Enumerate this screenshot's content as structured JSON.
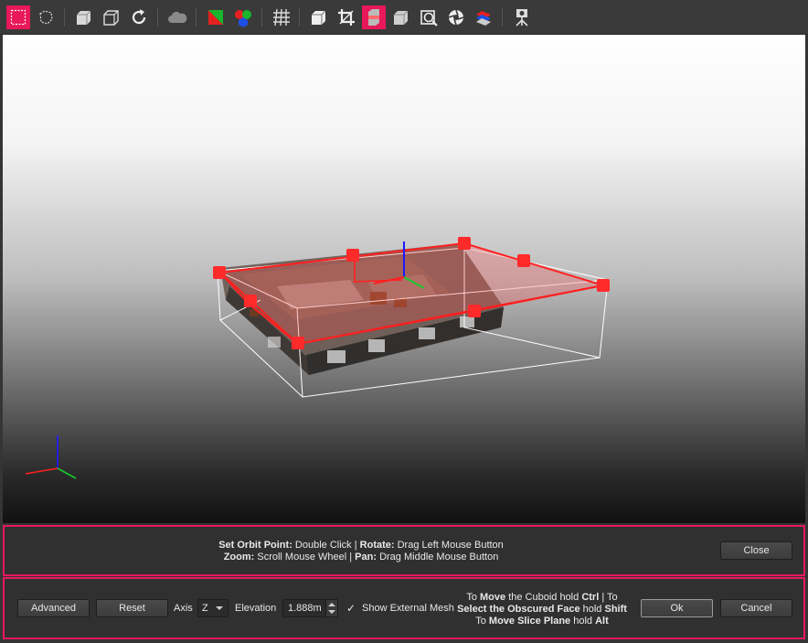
{
  "toolbar": {
    "buttons": [
      {
        "name": "rectangle-select-icon",
        "active": true
      },
      {
        "name": "lasso-select-icon",
        "active": false
      },
      {
        "name": "cuboid-add-icon",
        "active": false
      },
      {
        "name": "cuboid-remove-icon",
        "active": false
      },
      {
        "name": "rotate-icon",
        "active": false
      },
      {
        "name": "cloud-icon",
        "active": false
      },
      {
        "name": "color-icon",
        "active": false
      },
      {
        "name": "rgb-icon",
        "active": false
      },
      {
        "name": "grid-icon",
        "active": false
      },
      {
        "name": "box-view-icon",
        "active": false
      },
      {
        "name": "crop-icon",
        "active": false
      },
      {
        "name": "slice-icon",
        "active": true
      },
      {
        "name": "mesh-icon",
        "active": false
      },
      {
        "name": "camera-view-icon",
        "active": false
      },
      {
        "name": "aperture-icon",
        "active": false
      },
      {
        "name": "layers-icon",
        "active": false
      },
      {
        "name": "scanner-icon",
        "active": false
      }
    ]
  },
  "help": {
    "orbit_label": "Set Orbit Point:",
    "orbit_value": "Double Click",
    "sep1": "|",
    "rotate_label": "Rotate:",
    "rotate_value": "Drag Left Mouse Button",
    "zoom_label": "Zoom:",
    "zoom_value": "Scroll Mouse Wheel",
    "sep2": "|",
    "pan_label": "Pan:",
    "pan_value": "Drag Middle Mouse Button",
    "close_label": "Close"
  },
  "controls": {
    "advanced_label": "Advanced",
    "reset_label": "Reset",
    "axis_label": "Axis",
    "axis_value": "Z",
    "elevation_label": "Elevation",
    "elevation_value": "1.888m",
    "show_mesh_check": "✓",
    "show_mesh_label": "Show External Mesh",
    "hint": {
      "l1_a": "To",
      "l1_b": "Move",
      "l1_c": "the Cuboid hold",
      "l1_d": "Ctrl",
      "l1_e": "| To",
      "l2_a": "Select the Obscured Face",
      "l2_b": "hold",
      "l2_c": "Shift",
      "l3_a": "To",
      "l3_b": "Move Slice Plane",
      "l3_c": "hold",
      "l3_d": "Alt"
    },
    "ok_label": "Ok",
    "cancel_label": "Cancel"
  },
  "colors": {
    "accent": "#e8185a",
    "slice_plane": "#ff1f1f"
  }
}
